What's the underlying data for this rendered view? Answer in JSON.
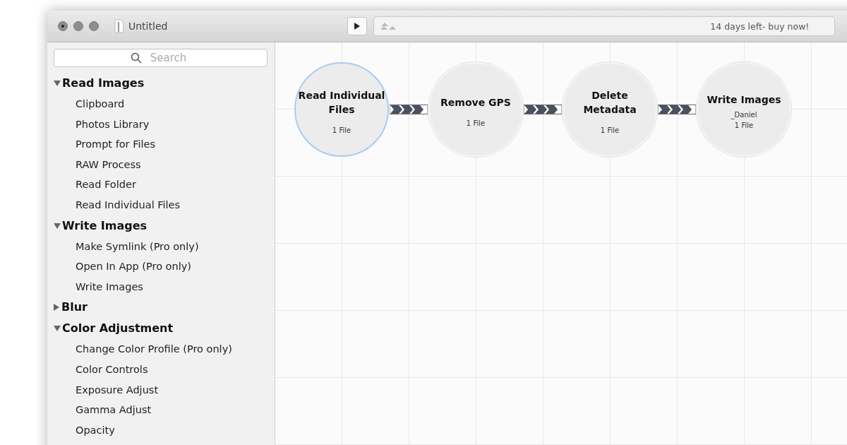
{
  "window": {
    "title": "Untitled"
  },
  "toolbar": {
    "status": "14 days left- buy now!"
  },
  "sidebar": {
    "search": {
      "placeholder": "Search"
    },
    "groups": [
      {
        "label": "Read Images",
        "expanded": true,
        "items": [
          "Clipboard",
          "Photos Library",
          "Prompt for Files",
          "RAW Process",
          "Read Folder",
          "Read Individual Files"
        ]
      },
      {
        "label": "Write Images",
        "expanded": true,
        "items": [
          "Make Symlink (Pro only)",
          "Open In App (Pro only)",
          "Write Images"
        ]
      },
      {
        "label": "Blur",
        "expanded": false
      },
      {
        "label": "Color Adjustment",
        "expanded": true,
        "items": [
          "Change Color Profile (Pro only)",
          "Color Controls",
          "Exposure Adjust",
          "Gamma Adjust",
          "Opacity"
        ]
      }
    ]
  },
  "workflow": {
    "nodes": [
      {
        "title": "Read Individual Files",
        "count": "1 File",
        "selected": true
      },
      {
        "title": "Remove GPS",
        "count": "1 File",
        "selected": false
      },
      {
        "title": "Delete Metadata",
        "count": "1 File",
        "selected": false
      },
      {
        "title": "Write Images",
        "detail": "_Daniel",
        "count": "1 File",
        "selected": false
      }
    ]
  }
}
